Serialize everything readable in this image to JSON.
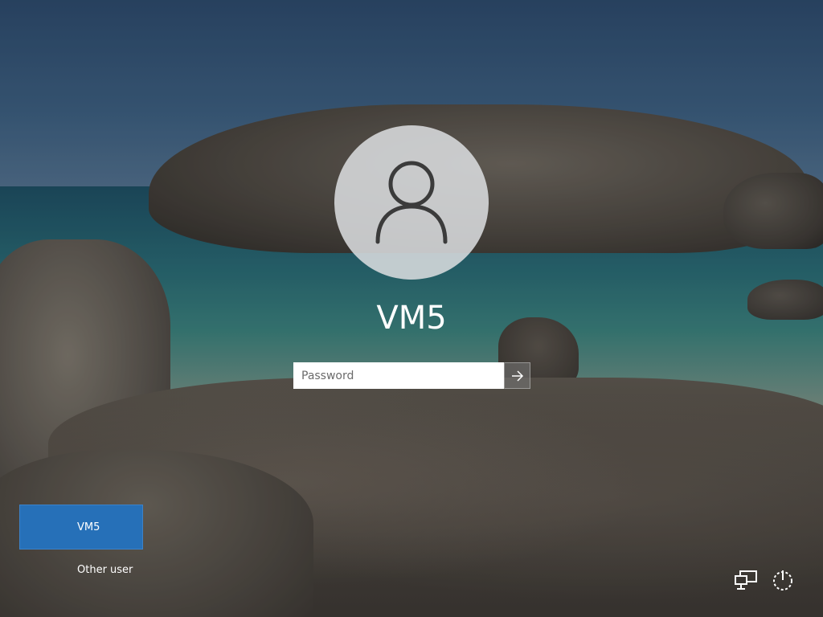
{
  "login": {
    "username": "VM5",
    "password_placeholder": "Password"
  },
  "user_list": {
    "items": [
      {
        "label": "VM5",
        "selected": true
      },
      {
        "label": "Other user",
        "selected": false
      }
    ]
  },
  "tray": {
    "icons": [
      "network-icon",
      "power-icon"
    ]
  },
  "colors": {
    "selected_user_tile": "#2670b8",
    "avatar_circle": "#dcdee1",
    "text": "#ffffff"
  }
}
